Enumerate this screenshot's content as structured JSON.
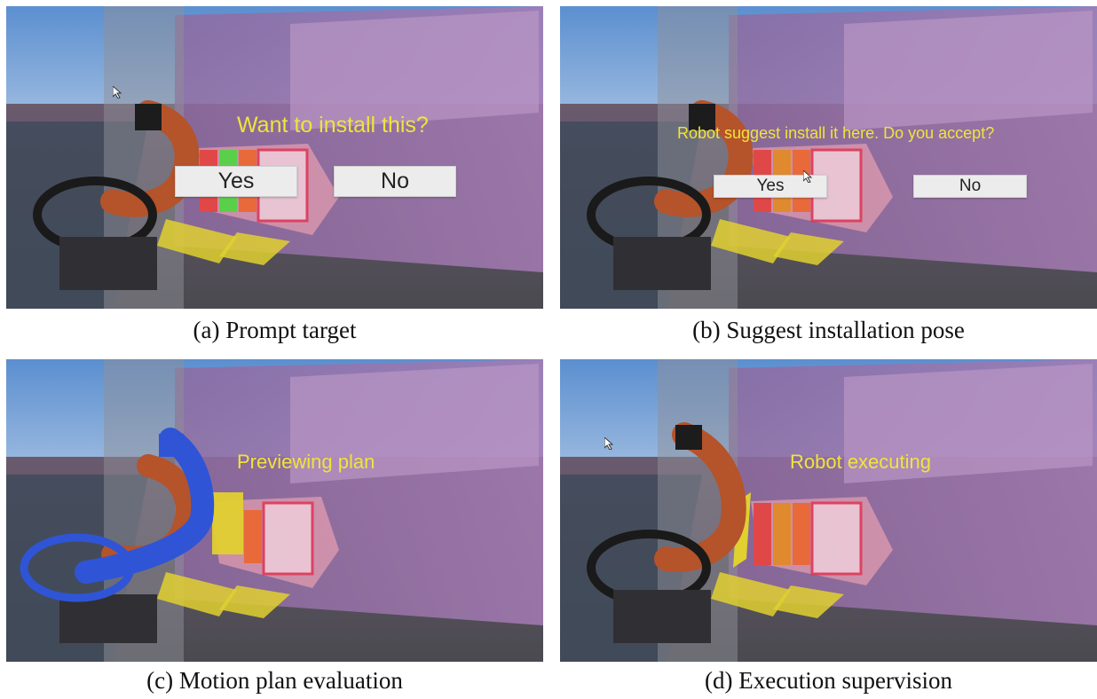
{
  "panels": [
    {
      "caption": "(a) Prompt target",
      "prompt": "Want to install this?",
      "buttons": {
        "yes": "Yes",
        "no": "No"
      }
    },
    {
      "caption": "(b) Suggest installation pose",
      "prompt": "Robot suggest install it here. Do you accept?",
      "buttons": {
        "yes": "Yes",
        "no": "No"
      }
    },
    {
      "caption": "(c) Motion plan evaluation",
      "status": "Previewing plan"
    },
    {
      "caption": "(d) Execution supervision",
      "status": "Robot executing"
    }
  ],
  "colors": {
    "overlay_text": "#f0e43a",
    "wall_purple": "#9a6ca8",
    "robot_orange": "#b5532a",
    "preview_blue": "#2f55d6",
    "shelf_red": "#e0404a",
    "panel_yellow": "#d8c92a"
  }
}
